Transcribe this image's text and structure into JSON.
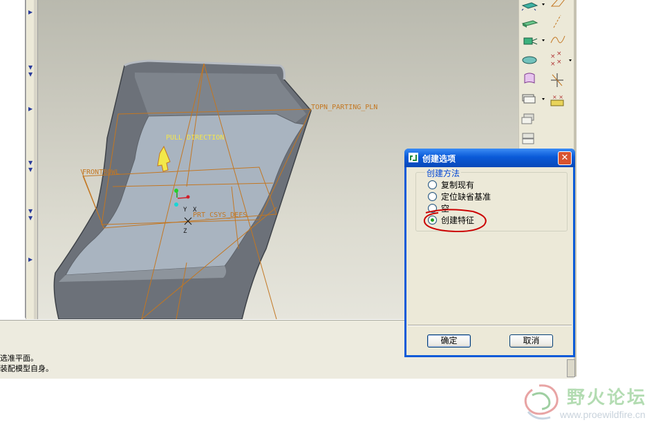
{
  "viewport": {
    "labels": {
      "pull_direction": "PULL DIRECTION",
      "top_parting_pln": "TOPN_PARTING_PLN",
      "front_bowl": "FRONTBOWL",
      "prt_csys_defs": "PRT_CSYS_DEFS",
      "axis_x": "X",
      "axis_y": "Y",
      "axis_z": "Z"
    }
  },
  "toolbar": {
    "icons": [
      "datum-plane-icon",
      "datum-axis-icon",
      "extrude-icon",
      "sketch-curve-icon",
      "revolve-icon",
      "datum-point-icon",
      "sweep-icon",
      "csys-icon",
      "blend-icon",
      "analysis-icon",
      "copy-feature-icon",
      "pattern-icon"
    ]
  },
  "messages": {
    "line1": "选准平面。",
    "line2": "装配模型自身。"
  },
  "dialog": {
    "title": "创建选项",
    "close_label": "✕",
    "group_label": "创建方法",
    "options": [
      {
        "label": "复制现有",
        "checked": false
      },
      {
        "label": "定位缺省基准",
        "checked": false
      },
      {
        "label": "空",
        "checked": false
      },
      {
        "label": "创建特征",
        "checked": true
      }
    ],
    "ok_label": "确定",
    "cancel_label": "取消"
  },
  "watermark": {
    "brand": "野火论坛",
    "url": "www.proewildfire.cn"
  },
  "colors": {
    "title_bar": "#0a5ad8",
    "datum_orange": "#c37722",
    "annotation_red": "#cc0000",
    "part_gray": "#6c7179",
    "part_face": "#a9b4c0"
  }
}
